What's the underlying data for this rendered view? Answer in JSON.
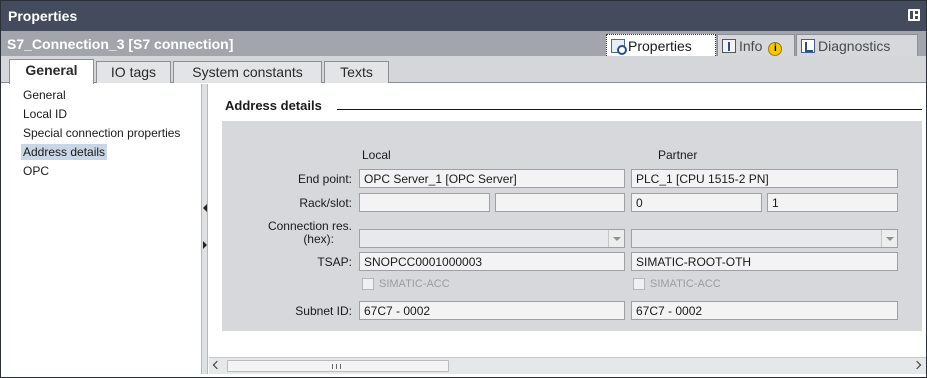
{
  "window": {
    "title": "Properties"
  },
  "object_header": {
    "title": "S7_Connection_3 [S7 connection]",
    "view_tabs": [
      {
        "label": "Properties",
        "icon": "properties-icon",
        "active": true
      },
      {
        "label": "Info",
        "icon": "info-icon",
        "badge": "i"
      },
      {
        "label": "Diagnostics",
        "icon": "diagnostics-icon"
      }
    ]
  },
  "tabs": [
    {
      "label": "General",
      "active": true
    },
    {
      "label": "IO tags"
    },
    {
      "label": "System constants"
    },
    {
      "label": "Texts"
    }
  ],
  "nav": {
    "items": [
      {
        "label": "General"
      },
      {
        "label": "Local ID"
      },
      {
        "label": "Special connection properties"
      },
      {
        "label": "Address details",
        "selected": true
      },
      {
        "label": "OPC"
      }
    ]
  },
  "section": {
    "title": "Address details"
  },
  "address_details": {
    "local_header": "Local",
    "partner_header": "Partner",
    "end_point_label": "End point:",
    "end_point_local": "OPC Server_1 [OPC Server]",
    "end_point_partner": "PLC_1 [CPU 1515-2 PN]",
    "rack_slot_label": "Rack/slot:",
    "rack_local": "",
    "slot_local": "",
    "rack_partner": "0",
    "slot_partner": "1",
    "conn_res_label_1": "Connection res.",
    "conn_res_label_2": "(hex):",
    "conn_res_local": "",
    "conn_res_partner": "",
    "tsap_label": "TSAP:",
    "tsap_local": "SNOPCC0001000003",
    "tsap_partner": "SIMATIC-ROOT-OTH",
    "simatic_acc_local": "SIMATIC-ACC",
    "simatic_acc_partner": "SIMATIC-ACC",
    "subnet_label": "Subnet ID:",
    "subnet_local": "67C7 - 0002",
    "subnet_partner": "67C7 - 0002"
  },
  "scrollbar": {
    "grip": "III"
  }
}
